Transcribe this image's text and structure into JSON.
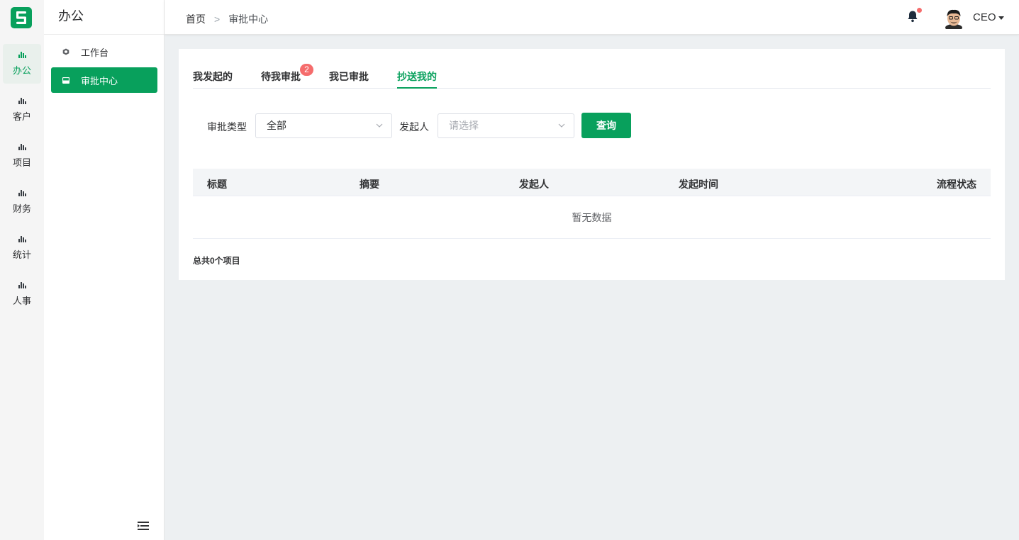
{
  "rail": {
    "items": [
      {
        "label": "办公",
        "active": true
      },
      {
        "label": "客户",
        "active": false
      },
      {
        "label": "项目",
        "active": false
      },
      {
        "label": "财务",
        "active": false
      },
      {
        "label": "统计",
        "active": false
      },
      {
        "label": "人事",
        "active": false
      }
    ]
  },
  "subside": {
    "title": "办公",
    "menu": [
      {
        "label": "工作台",
        "icon": "cube-icon"
      },
      {
        "label": "审批中心",
        "icon": "inbox-icon"
      }
    ]
  },
  "header": {
    "breadcrumb": {
      "home": "首页",
      "separator": ">",
      "current": "审批中心"
    },
    "user": "CEO"
  },
  "tabs": {
    "items": [
      {
        "label": "我发起的"
      },
      {
        "label": "待我审批",
        "badge": "2"
      },
      {
        "label": "我已审批"
      },
      {
        "label": "抄送我的",
        "active": true
      }
    ]
  },
  "filters": {
    "type_label": "审批类型",
    "type_value": "全部",
    "initiator_label": "发起人",
    "initiator_placeholder": "请选择",
    "query_button": "查询"
  },
  "table": {
    "columns": [
      "标题",
      "摘要",
      "发起人",
      "发起时间",
      "流程状态"
    ],
    "rows": [],
    "empty_text": "暂无数据"
  },
  "pagination": {
    "total_text": "总共0个项目"
  },
  "colors": {
    "accent": "#08a05c",
    "badge": "#f56c6c",
    "background": "#edf0f2"
  }
}
